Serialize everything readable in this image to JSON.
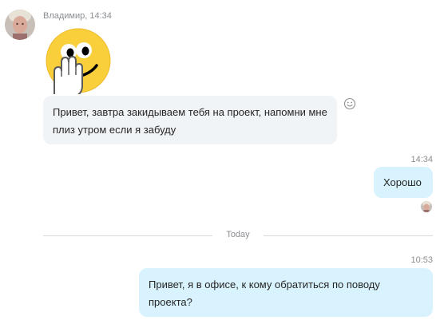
{
  "conversation": {
    "incoming": {
      "sender_time": "Владимир, 14:34",
      "emoticon": "wave-emoticon",
      "text": "Привет, завтра закидываем тебя на проект, напомни мне плиз утром если я забуду",
      "reaction_icon": "smiley-icon"
    },
    "outgoing_1": {
      "time": "14:34",
      "text": "Хорошо"
    },
    "date_divider": "Today",
    "outgoing_2": {
      "time": "10:53",
      "text": "Привет, я в офисе, к кому обратиться по поводу проекта?"
    }
  },
  "colors": {
    "incoming_bubble": "#f1f4f7",
    "outgoing_bubble": "#d8f3fd",
    "meta_text": "#8a8d91",
    "emoticon_face": "#f9cf3c"
  }
}
